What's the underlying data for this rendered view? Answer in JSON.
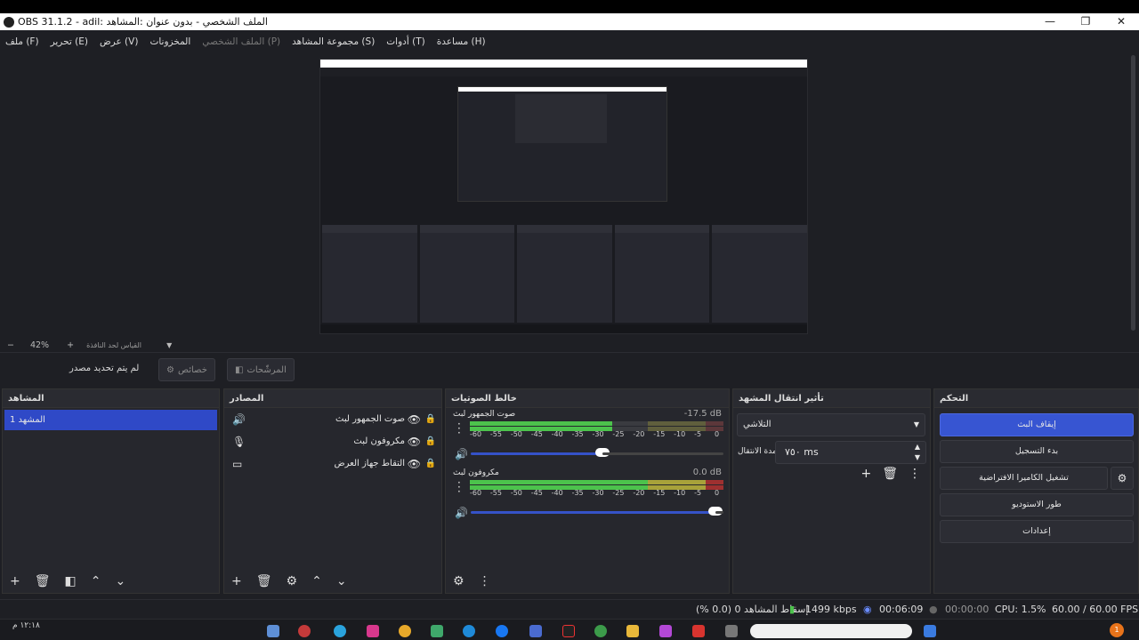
{
  "window": {
    "title": "OBS 31.1.2 - adil: الملف الشخصي - بدون عنوان :المشاهد",
    "min": "—",
    "max": "❐",
    "close": "✕"
  },
  "menu": [
    "ملف (F)",
    "تحرير (E)",
    "عرض (V)",
    "المخزونات",
    "الملف الشخصي (P)",
    "مجموعة المشاهد (S)",
    "أدوات (T)",
    "مساعدة (H)"
  ],
  "zoom": {
    "minus": "−",
    "value": "42%",
    "plus": "+",
    "scale_label": "القياس لحد النافذة"
  },
  "source_bar": {
    "no_source": "لم يتم تحديد مصدر",
    "properties": "خصائص",
    "filters": "المرشّحات"
  },
  "scenes": {
    "header": "المشاهد",
    "items": [
      "المشهد 1"
    ]
  },
  "sources": {
    "header": "المصادر",
    "items": [
      {
        "label": "صوت الجمهور لبث",
        "icon": "speaker-icon",
        "glyph": "🔊"
      },
      {
        "label": "مكروفون لبث",
        "icon": "microphone-icon",
        "glyph": "🎙"
      },
      {
        "label": "التقاط جهاز العرض",
        "icon": "monitor-icon",
        "glyph": "▭"
      }
    ]
  },
  "mixer": {
    "header": "خالط الصوتيات",
    "tracks": [
      {
        "name": "صوت الجمهور لبث",
        "db": "-17.5 dB",
        "level": 0.56,
        "volume": 0.52
      },
      {
        "name": "مكروفون لبث",
        "db": "0.0 dB",
        "level": 0.95,
        "volume": 0.97
      }
    ],
    "scale": [
      "-60",
      "-55",
      "-50",
      "-45",
      "-40",
      "-35",
      "-30",
      "-25",
      "-20",
      "-15",
      "-10",
      "-5",
      "0"
    ]
  },
  "transitions": {
    "header": "تأثير انتقال المشهد",
    "selected": "التلاشي",
    "duration_label": "مدة الانتقال",
    "duration": "٧٥٠ ms"
  },
  "controls": {
    "header": "التحكم",
    "stop_stream": "إيقاف البث",
    "start_record": "بدء التسجيل",
    "virtual_cam": "تشغيل الكاميرا الافتراضية",
    "studio": "طور الاستوديو",
    "settings": "إعدادات"
  },
  "status": {
    "dropped": "إسقاط المشاهد 0 (0.0 %)",
    "kbps": "1499 kbps",
    "stream_time": "00:06:09",
    "rec_time": "00:00:00",
    "cpu": "CPU: 1.5%",
    "fps": "60.00 / 60.00 FPS"
  },
  "taskbar": {
    "time": "١٢:١٨ م",
    "badge": "1"
  },
  "colors": {
    "accent": "#3755d2",
    "meter_green": "#4cc34c",
    "meter_yellow": "#a8a23a",
    "meter_red": "#9e3030"
  }
}
